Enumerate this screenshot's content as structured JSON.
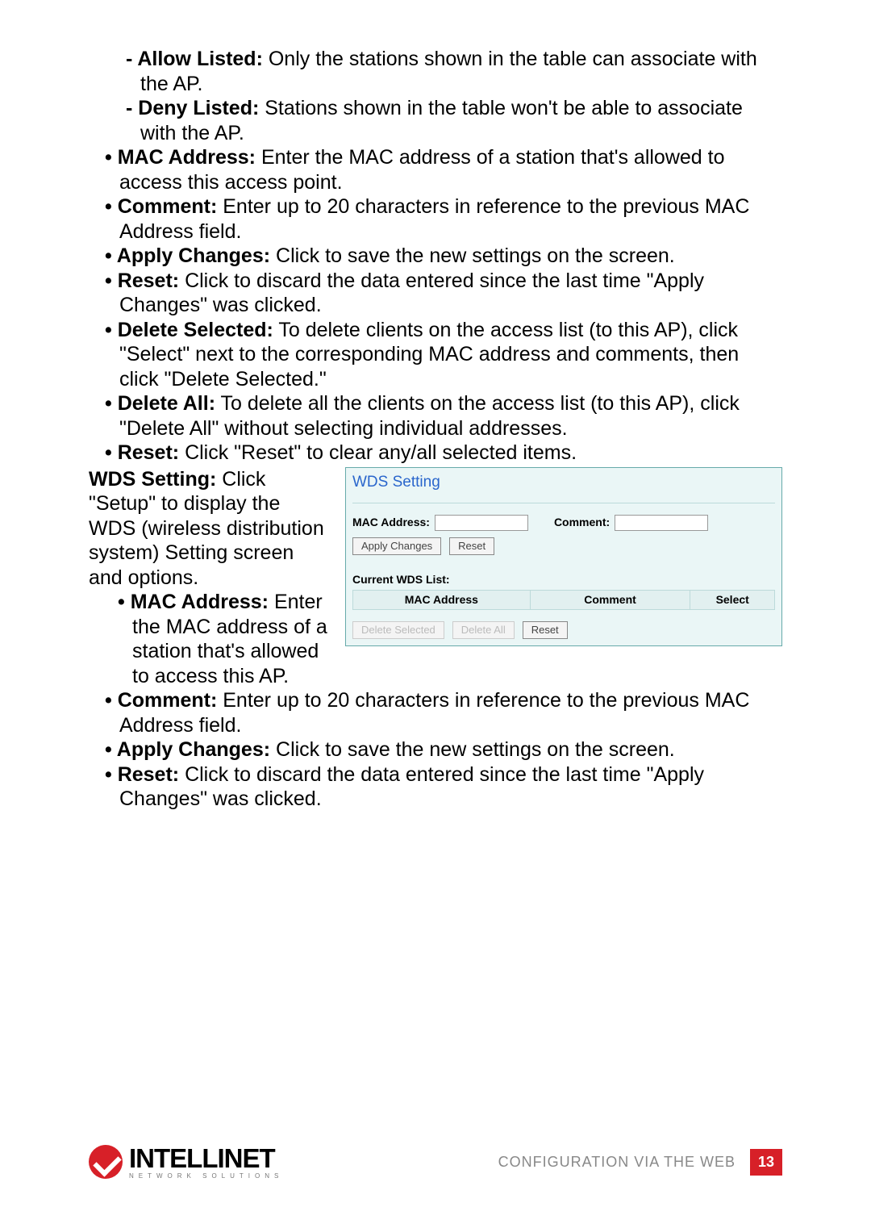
{
  "intro": {
    "allow_listed_label": "- Allow Listed:",
    "allow_listed_text": " Only the stations shown in the table can associate with the AP.",
    "deny_listed_label": "- Deny Listed:",
    "deny_listed_text": " Stations shown in the table won't be able to associate with the AP.",
    "mac_label": "• MAC Address:",
    "mac_text": " Enter the MAC address of a station that's allowed to access this access point.",
    "comment_label": "• Comment:",
    "comment_text": " Enter up to 20 characters in reference to the previous MAC Address field.",
    "apply_label": "• Apply Changes:",
    "apply_text": " Click to save the new settings on the screen.",
    "reset1_label": "• Reset:",
    "reset1_text": " Click to discard the data entered since the last time \"Apply Changes\" was clicked.",
    "delsel_label": "• Delete Selected:",
    "delsel_text": " To delete clients on the access list (to this AP), click \"Select\" next to the corresponding MAC address and comments, then click \"Delete Selected.\"",
    "delall_label": "• Delete All:",
    "delall_text": " To delete all the clients on the access list (to this AP), click \"Delete All\" without selecting individual addresses.",
    "reset2_label": "• Reset:",
    "reset2_text": " Click \"Reset\" to clear any/all selected items."
  },
  "wds_intro": {
    "label": "WDS Setting:",
    "text": " Click \"Setup\" to display the WDS (wireless distribution system) Setting screen and options.",
    "mac_label": "• MAC Address:",
    "mac_text": "  Enter the MAC address of a station that's allowed to access this AP."
  },
  "panel": {
    "title": "WDS Setting",
    "mac_label": "MAC Address:",
    "comment_label": "Comment:",
    "apply_btn": "Apply Changes",
    "reset_btn": "Reset",
    "list_label": "Current WDS List:",
    "th_mac": "MAC Address",
    "th_comment": "Comment",
    "th_select": "Select",
    "del_sel_btn": "Delete Selected",
    "del_all_btn": "Delete All",
    "reset2_btn": "Reset"
  },
  "after": {
    "comment_label": "• Comment:",
    "comment_text": " Enter up to 20 characters in reference to the previous MAC Address field.",
    "apply_label": "• Apply Changes:",
    "apply_text": " Click to save the new settings on the screen.",
    "reset_label": "• Reset:",
    "reset_text": " Click to discard the data entered since the last time \"Apply Changes\" was clicked."
  },
  "footer": {
    "brand": "INTELLINET",
    "sub": "NETWORK SOLUTIONS",
    "section": "CONFIGURATION VIA THE WEB",
    "page": "13"
  }
}
